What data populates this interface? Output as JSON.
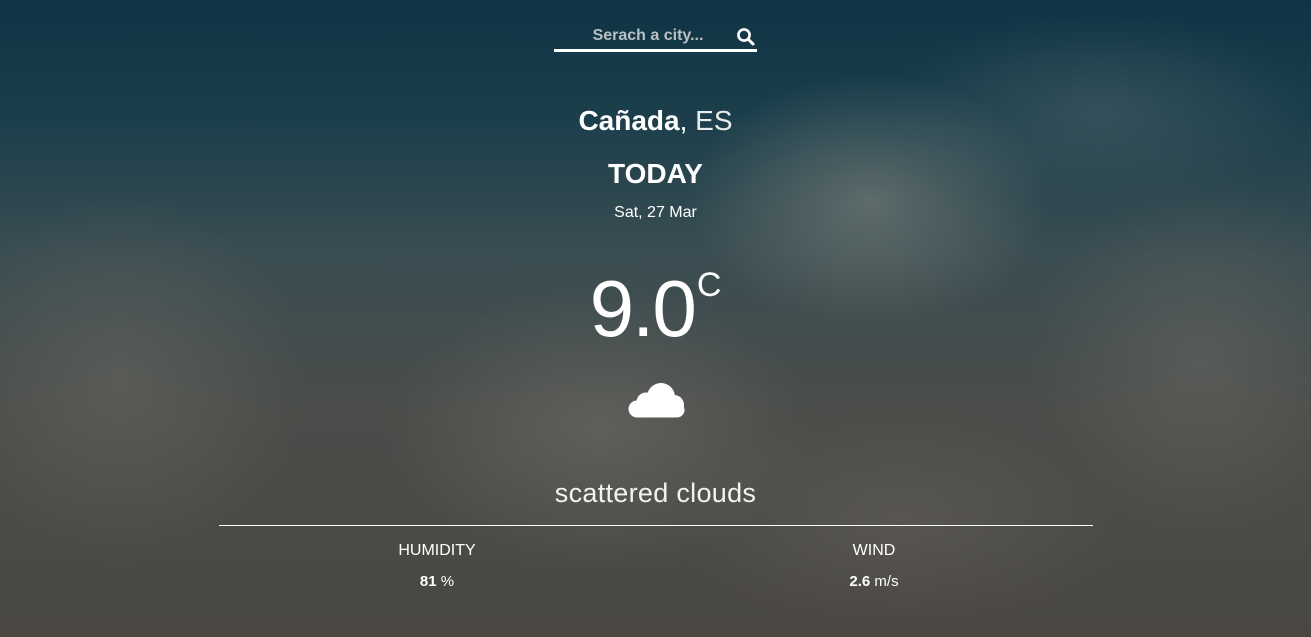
{
  "search": {
    "placeholder": "Serach a city...",
    "button_icon": "search-icon"
  },
  "location": {
    "city": "Cañada",
    "separator": ",",
    "country": "ES"
  },
  "forecast": {
    "day_label": "TODAY",
    "date": "Sat, 27 Mar",
    "temperature": "9.0",
    "temperature_unit": "C",
    "condition_icon": "cloud-icon",
    "description": "scattered clouds"
  },
  "details": {
    "humidity": {
      "label": "HUMIDITY",
      "value": "81",
      "unit": "%"
    },
    "wind": {
      "label": "WIND",
      "value": "2.6",
      "unit": "m/s"
    }
  },
  "colors": {
    "text": "#ffffff",
    "sky_dark": "#0f3444",
    "cloud_grey": "#4b4d4a"
  }
}
